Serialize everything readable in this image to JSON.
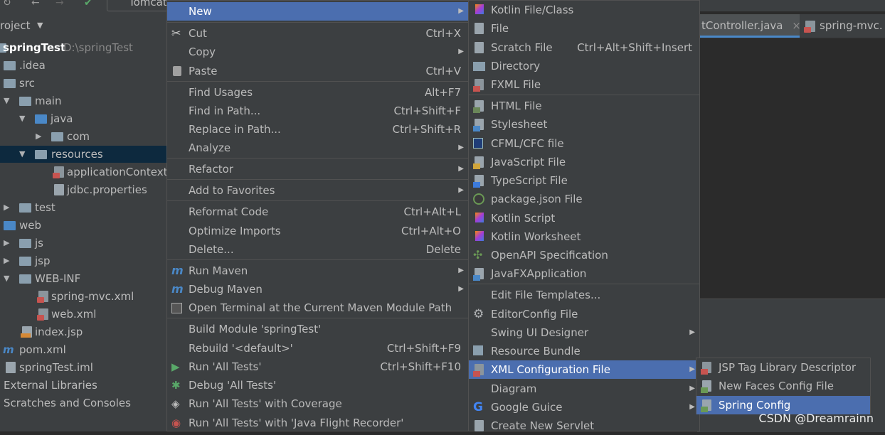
{
  "toolbar": {
    "run_config": "Tomcat"
  },
  "project": {
    "header": "roject",
    "tree": [
      {
        "label": "springTest",
        "hint": "D:\\springTest",
        "bold": true
      },
      {
        "label": ".idea"
      },
      {
        "label": "src"
      },
      {
        "label": "main"
      },
      {
        "label": "java"
      },
      {
        "label": "com"
      },
      {
        "label": "resources",
        "selected": true
      },
      {
        "label": "applicationContext"
      },
      {
        "label": "jdbc.properties"
      },
      {
        "label": "test"
      },
      {
        "label": "web"
      },
      {
        "label": "js"
      },
      {
        "label": "jsp"
      },
      {
        "label": "WEB-INF"
      },
      {
        "label": "spring-mvc.xml"
      },
      {
        "label": "web.xml"
      },
      {
        "label": "index.jsp"
      },
      {
        "label": "pom.xml"
      },
      {
        "label": "springTest.iml"
      },
      {
        "label": "External Libraries"
      },
      {
        "label": "Scratches and Consoles"
      }
    ]
  },
  "editor_tabs": [
    "tController.java",
    "spring-mvc."
  ],
  "context_menu": {
    "items": [
      {
        "label": "New",
        "shortcut": "",
        "submenu": true,
        "highlight": true
      },
      {
        "label": "Cut",
        "shortcut": "Ctrl+X"
      },
      {
        "label": "Copy",
        "shortcut": "",
        "submenu": true
      },
      {
        "label": "Paste",
        "shortcut": "Ctrl+V"
      },
      {
        "label": "Find Usages",
        "shortcut": "Alt+F7"
      },
      {
        "label": "Find in Path...",
        "shortcut": "Ctrl+Shift+F"
      },
      {
        "label": "Replace in Path...",
        "shortcut": "Ctrl+Shift+R"
      },
      {
        "label": "Analyze",
        "shortcut": "",
        "submenu": true
      },
      {
        "label": "Refactor",
        "shortcut": "",
        "submenu": true
      },
      {
        "label": "Add to Favorites",
        "shortcut": "",
        "submenu": true
      },
      {
        "label": "Reformat Code",
        "shortcut": "Ctrl+Alt+L"
      },
      {
        "label": "Optimize Imports",
        "shortcut": "Ctrl+Alt+O"
      },
      {
        "label": "Delete...",
        "shortcut": "Delete"
      },
      {
        "label": "Run Maven",
        "shortcut": "",
        "submenu": true
      },
      {
        "label": "Debug Maven",
        "shortcut": "",
        "submenu": true
      },
      {
        "label": "Open Terminal at the Current Maven Module Path",
        "shortcut": ""
      },
      {
        "label": "Build Module 'springTest'",
        "shortcut": ""
      },
      {
        "label": "Rebuild '<default>'",
        "shortcut": "Ctrl+Shift+F9"
      },
      {
        "label": "Run 'All Tests'",
        "shortcut": "Ctrl+Shift+F10"
      },
      {
        "label": "Debug 'All Tests'",
        "shortcut": ""
      },
      {
        "label": "Run 'All Tests' with Coverage",
        "shortcut": ""
      },
      {
        "label": "Run 'All Tests' with 'Java Flight Recorder'",
        "shortcut": ""
      }
    ]
  },
  "new_submenu": {
    "items": [
      {
        "label": "Kotlin File/Class",
        "shortcut": ""
      },
      {
        "label": "File",
        "shortcut": ""
      },
      {
        "label": "Scratch File",
        "shortcut": "Ctrl+Alt+Shift+Insert"
      },
      {
        "label": "Directory",
        "shortcut": ""
      },
      {
        "label": "FXML File",
        "shortcut": ""
      },
      {
        "label": "HTML File",
        "shortcut": ""
      },
      {
        "label": "Stylesheet",
        "shortcut": ""
      },
      {
        "label": "CFML/CFC file",
        "shortcut": ""
      },
      {
        "label": "JavaScript File",
        "shortcut": ""
      },
      {
        "label": "TypeScript File",
        "shortcut": ""
      },
      {
        "label": "package.json File",
        "shortcut": ""
      },
      {
        "label": "Kotlin Script",
        "shortcut": ""
      },
      {
        "label": "Kotlin Worksheet",
        "shortcut": ""
      },
      {
        "label": "OpenAPI Specification",
        "shortcut": ""
      },
      {
        "label": "JavaFXApplication",
        "shortcut": ""
      },
      {
        "label": "Edit File Templates...",
        "shortcut": ""
      },
      {
        "label": "EditorConfig File",
        "shortcut": ""
      },
      {
        "label": "Swing UI Designer",
        "shortcut": "",
        "submenu": true
      },
      {
        "label": "Resource Bundle",
        "shortcut": ""
      },
      {
        "label": "XML Configuration File",
        "shortcut": "",
        "submenu": true,
        "highlight": true
      },
      {
        "label": "Diagram",
        "shortcut": "",
        "submenu": true
      },
      {
        "label": "Google Guice",
        "shortcut": "",
        "submenu": true
      },
      {
        "label": "Create New Servlet",
        "shortcut": ""
      }
    ]
  },
  "xml_submenu": {
    "items": [
      {
        "label": "JSP Tag Library Descriptor"
      },
      {
        "label": "New Faces Config File"
      },
      {
        "label": "Spring Config",
        "highlight": true
      }
    ]
  },
  "watermark": "CSDN @Dreamrainn",
  "colors": {
    "highlight": "#4b6eaf",
    "background": "#3c3f41",
    "selection": "#0d293e"
  }
}
